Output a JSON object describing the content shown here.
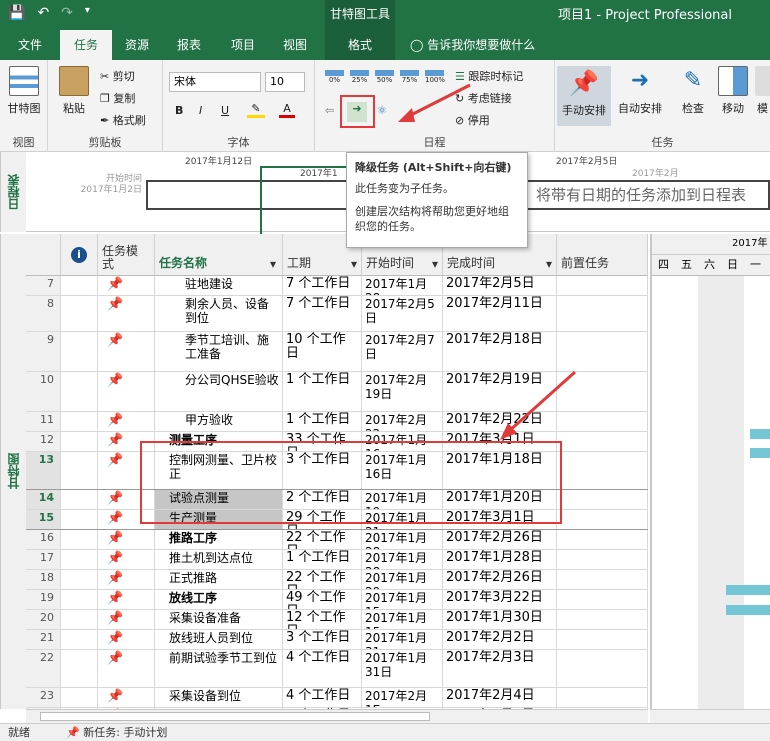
{
  "window": {
    "context_tool": "甘特图工具",
    "title": "项目1 - Project Professional"
  },
  "tabs": [
    {
      "label": "文件"
    },
    {
      "label": "任务"
    },
    {
      "label": "资源"
    },
    {
      "label": "报表"
    },
    {
      "label": "项目"
    },
    {
      "label": "视图"
    },
    {
      "label": "格式"
    }
  ],
  "tell_me": "告诉我你想要做什么",
  "ribbon": {
    "view_group": {
      "label": "视图",
      "gantt": "甘特图"
    },
    "clipboard": {
      "label": "剪贴板",
      "paste": "粘贴",
      "cut": "剪切",
      "copy": "复制",
      "format_painter": "格式刷"
    },
    "font": {
      "label": "字体",
      "name": "宋体",
      "size": "10"
    },
    "schedule": {
      "label": "日程",
      "percent": [
        "0%",
        "25%",
        "50%",
        "75%",
        "100%"
      ],
      "mark_on_track": "跟踪时标记",
      "respect_links": "考虑链接",
      "inactivate": "停用"
    },
    "tasks_group": {
      "label": "任务",
      "manual": "手动安排",
      "auto": "自动安排",
      "inspect": "检查",
      "move": "移动",
      "mode": "模"
    }
  },
  "tooltip": {
    "title": "降级任务 (Alt+Shift+向右键)",
    "line1": "此任务变为子任务。",
    "line2": "创建层次结构将帮助您更好地组织您的任务。"
  },
  "timeline": {
    "label": "日程表",
    "start_label": "开始时间",
    "start_date": "2017年1月2日",
    "date1": "2017年1月12日",
    "date2": "2017年1",
    "date3": "2017年2月5日",
    "date4": "2017年2月",
    "placeholder": "将带有日期的任务添加到日程表"
  },
  "side_label": "甘特图",
  "columns": {
    "mode": "任务模式",
    "name": "任务名称",
    "duration": "工期",
    "start": "开始时间",
    "finish": "完成时间",
    "pred": "前置任务"
  },
  "rows": [
    {
      "id": "7",
      "name": "驻地建设",
      "duration": "7 个工作日",
      "start": "2017年1月28",
      "finish": "2017年2月5日"
    },
    {
      "id": "8",
      "name": "剩余人员、设备到位",
      "duration": "7 个工作日",
      "start": "2017年2月5日",
      "finish": "2017年2月11日"
    },
    {
      "id": "9",
      "name": "季节工培训、施工准备",
      "duration": "10 个工作日",
      "start": "2017年2月7日",
      "finish": "2017年2月18日"
    },
    {
      "id": "10",
      "name": "分公司QHSE验收",
      "duration": "1 个工作日",
      "start": "2017年2月19日",
      "finish": "2017年2月19日"
    },
    {
      "id": "11",
      "name": "甲方验收",
      "duration": "1 个工作日",
      "start": "2017年2月22",
      "finish": "2017年2月22日"
    },
    {
      "id": "12",
      "name": "测量工序",
      "duration": "33 个工作日",
      "start": "2017年1月16",
      "finish": "2017年3月1日"
    },
    {
      "id": "13",
      "name": "控制网测量、卫片校正",
      "duration": "3 个工作日",
      "start": "2017年1月16日",
      "finish": "2017年1月18日"
    },
    {
      "id": "14",
      "name": "试验点测量",
      "duration": "2 个工作日",
      "start": "2017年1月19",
      "finish": "2017年1月20日"
    },
    {
      "id": "15",
      "name": "生产测量",
      "duration": "29 个工作日",
      "start": "2017年1月21",
      "finish": "2017年3月1日"
    },
    {
      "id": "16",
      "name": "推路工序",
      "duration": "22 个工作日",
      "start": "2017年1月28",
      "finish": "2017年2月26日"
    },
    {
      "id": "17",
      "name": "推土机到达点位",
      "duration": "1 个工作日",
      "start": "2017年1月28",
      "finish": "2017年1月28日"
    },
    {
      "id": "18",
      "name": "正式推路",
      "duration": "22 个工作日",
      "start": "2017年1月29",
      "finish": "2017年2月26日"
    },
    {
      "id": "19",
      "name": "放线工序",
      "duration": "49 个工作日",
      "start": "2017年1月15",
      "finish": "2017年3月22日"
    },
    {
      "id": "20",
      "name": "采集设备准备",
      "duration": "12 个工作日",
      "start": "2017年1月15",
      "finish": "2017年1月30日"
    },
    {
      "id": "21",
      "name": "放线班人员到位",
      "duration": "3 个工作日",
      "start": "2017年1月31",
      "finish": "2017年2月2日"
    },
    {
      "id": "22",
      "name": "前期试验季节工到位",
      "duration": "4 个工作日",
      "start": "2017年1月31日",
      "finish": "2017年2月3日"
    },
    {
      "id": "23",
      "name": "采集设备到位",
      "duration": "4 个工作日",
      "start": "2017年2月1E",
      "finish": "2017年2月4日"
    },
    {
      "id": "24",
      "name": "仪器车、排列车到",
      "duration": "1 个工作日",
      "start": "2017年2月",
      "finish": "2017年2月5日"
    }
  ],
  "gantt_header": {
    "week": "2017年1",
    "days": [
      "四",
      "五",
      "六",
      "日",
      "一"
    ]
  },
  "status": {
    "ready": "就绪",
    "new_task": "新任务: 手动计划"
  }
}
